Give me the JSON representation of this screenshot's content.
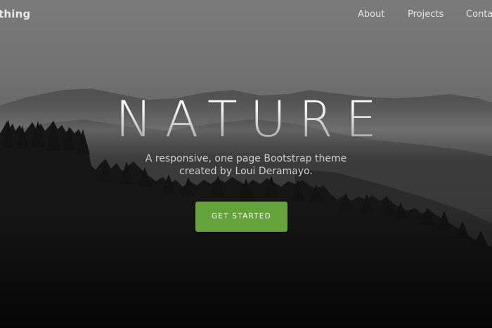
{
  "nav": {
    "brand": "thing",
    "links": [
      {
        "label": "About"
      },
      {
        "label": "Projects"
      },
      {
        "label": "Contac"
      }
    ]
  },
  "hero": {
    "title": "NATURE",
    "subtitle_line1": "A responsive, one page Bootstrap theme",
    "subtitle_line2": "created by Loui Deramayo.",
    "cta_label": "GET STARTED"
  },
  "colors": {
    "accent": "#64a23a",
    "text_light": "#e2e2e2",
    "background_top": "#7a7a7a",
    "background_bottom": "#0e0e0e"
  }
}
